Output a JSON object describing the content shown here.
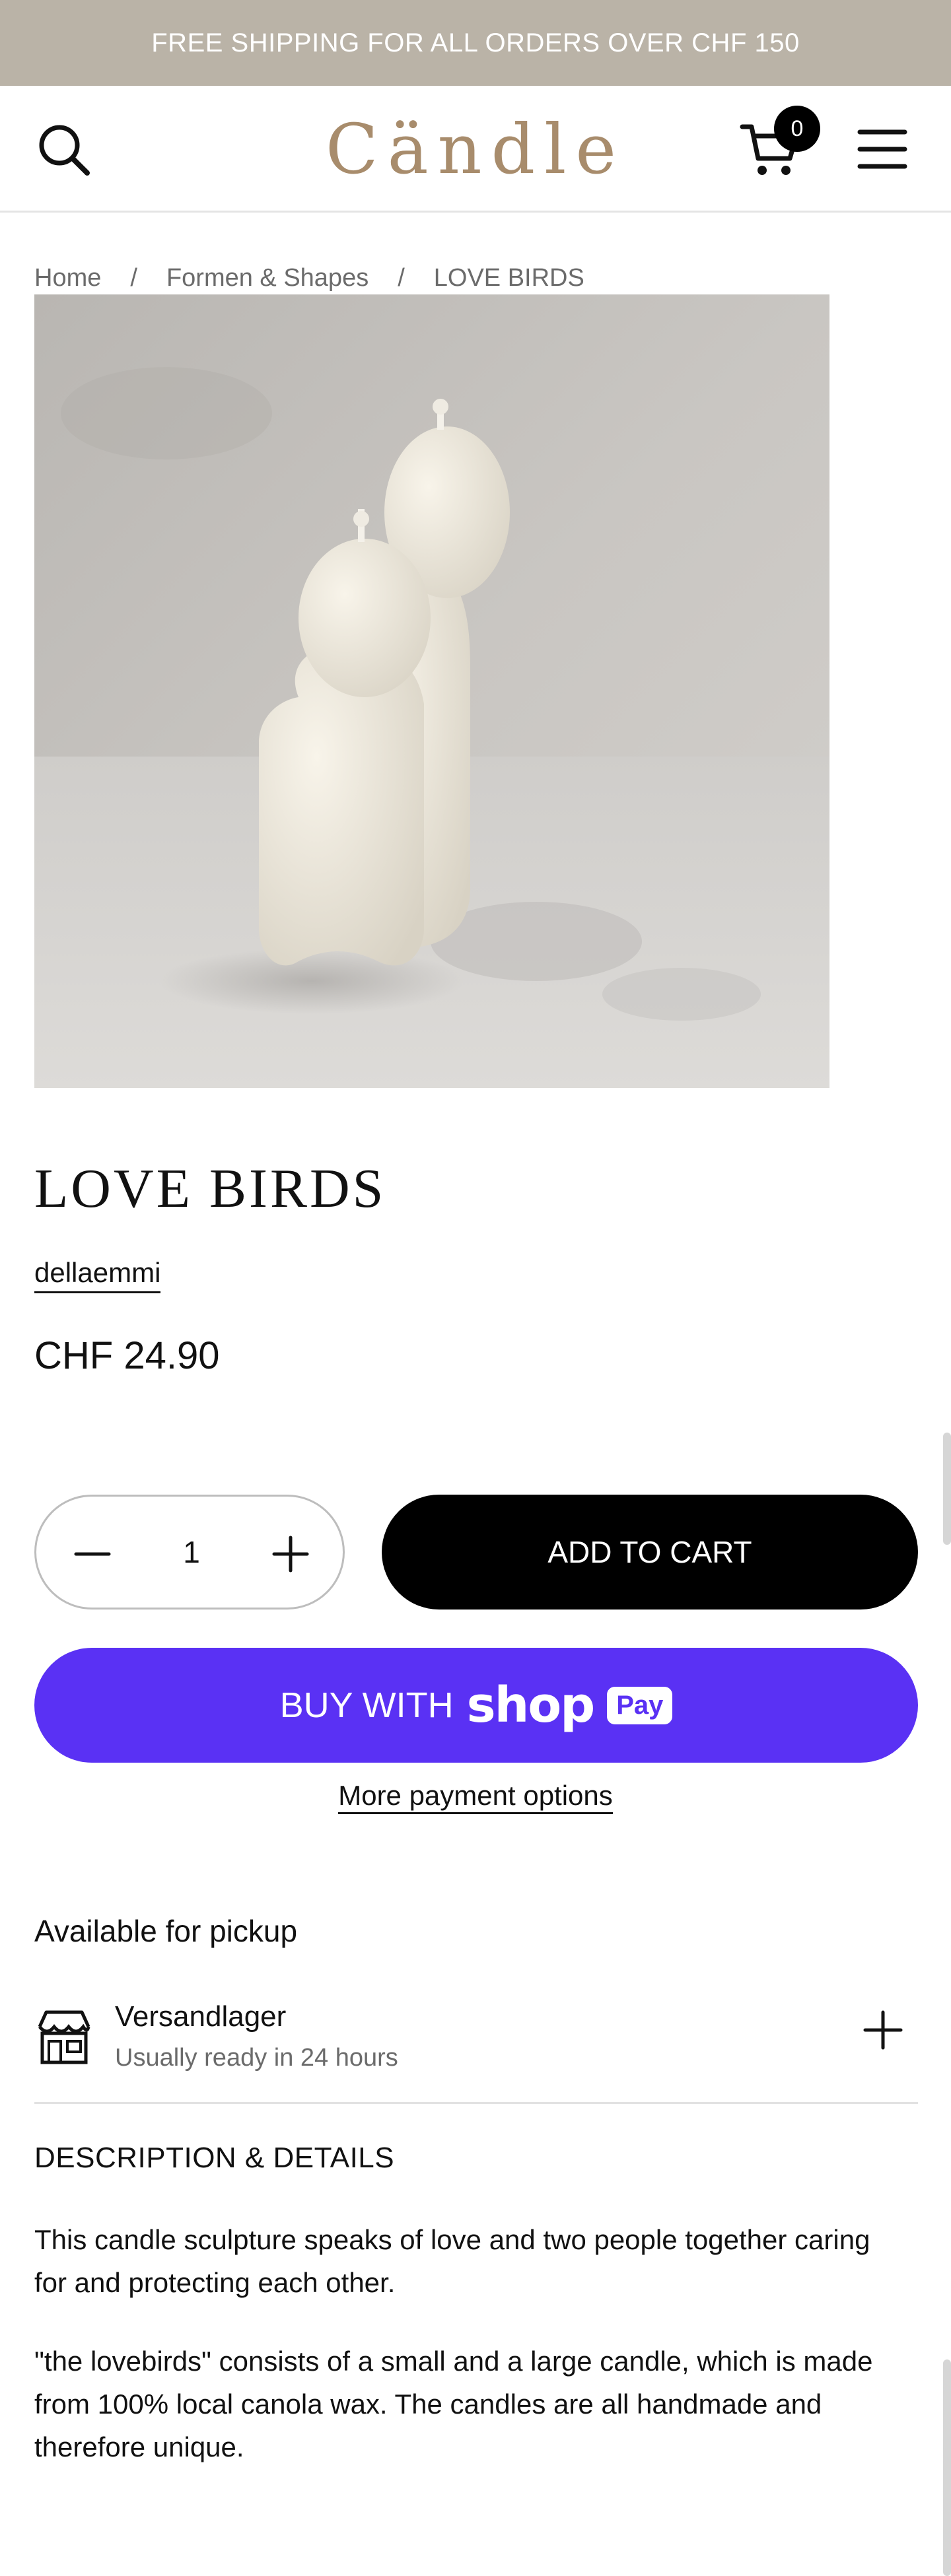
{
  "announcement": {
    "text": "FREE SHIPPING FOR ALL ORDERS OVER CHF 150"
  },
  "header": {
    "logo_text": "Cändle",
    "cart_count": "0",
    "icons": {
      "search": "search-icon",
      "cart": "cart-icon",
      "menu": "menu-icon"
    }
  },
  "breadcrumb": {
    "items": [
      "Home",
      "Formen & Shapes",
      "LOVE BIRDS"
    ],
    "separator": "/"
  },
  "product": {
    "title": "LOVE BIRDS",
    "vendor": "dellaemmi",
    "price": "CHF 24.90",
    "quantity": "1",
    "add_to_cart_label": "ADD TO CART",
    "shop_pay": {
      "buy_with": "BUY WITH",
      "shop": "shop",
      "pay": "Pay"
    },
    "more_payment_options": "More payment options"
  },
  "pickup": {
    "title": "Available for pickup",
    "location_name": "Versandlager",
    "location_note": "Usually ready in 24 hours"
  },
  "description": {
    "heading": "DESCRIPTION & DETAILS",
    "paragraphs": [
      "This candle sculpture speaks of love and two people together caring for and protecting each other.",
      "\"the lovebirds\" consists of a small and a large candle, which is made from 100% local canola wax. The candles are all handmade and therefore unique."
    ]
  },
  "colors": {
    "announcement_bg": "#bab3a7",
    "logo": "#a88c6c",
    "shop_pay": "#5a31f4",
    "button": "#000000"
  }
}
